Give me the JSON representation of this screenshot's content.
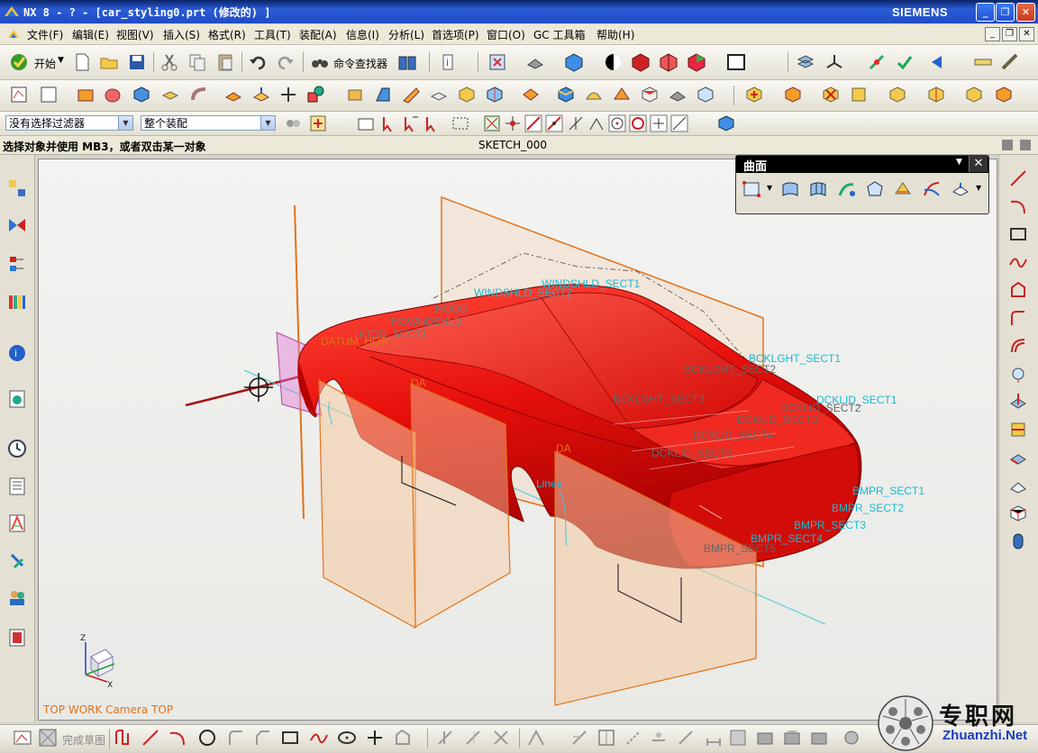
{
  "window": {
    "title": "NX 8 - ? - [car_styling0.prt  (修改的) ]",
    "brand": "SIEMENS",
    "minimize": "_",
    "restore": "❐",
    "close": "✕"
  },
  "menu": {
    "items": [
      "文件(F)",
      "编辑(E)",
      "视图(V)",
      "插入(S)",
      "格式(R)",
      "工具(T)",
      "装配(A)",
      "信息(I)",
      "分析(L)",
      "首选项(P)",
      "窗口(O)",
      "GC 工具箱",
      "帮助(H)"
    ]
  },
  "toolbar": {
    "start_label": "开始",
    "command_finder_label": "命令查找器"
  },
  "selection": {
    "filter_value": "没有选择过滤器",
    "scope_value": "整个装配"
  },
  "cue": {
    "text": "选择对象并使用 MB3，或者双击某一对象",
    "status": "SKETCH_000"
  },
  "panel": {
    "title": "曲面"
  },
  "viewport": {
    "view_name": "TOP WORK Camera TOP",
    "labels": [
      {
        "text": "WINDSHLD_SECT1",
        "color": "cyan"
      },
      {
        "text": "WINDSHLD_SECT2",
        "color": "cyan"
      },
      {
        "text": "HOOD",
        "color": "gray"
      },
      {
        "text": "HOWNDSHLD",
        "color": "gray"
      },
      {
        "text": "HOOD_SECT1",
        "color": "gray"
      },
      {
        "text": "DATUM_HOR",
        "color": "orange"
      },
      {
        "text": "BCKLGHT_SECT1",
        "color": "cyan"
      },
      {
        "text": "BCKLGHT_SECT2",
        "color": "gray"
      },
      {
        "text": "BCKLGHT_SECT3",
        "color": "gray"
      },
      {
        "text": "DCKLID_SECT1",
        "color": "cyan"
      },
      {
        "text": "DCKLID_SECT2",
        "color": "gray"
      },
      {
        "text": "DCKLID_SECT3",
        "color": "gray"
      },
      {
        "text": "DCKLID_SECT4",
        "color": "gray"
      },
      {
        "text": "DCKLID_SECT5",
        "color": "gray"
      },
      {
        "text": "BMPR_SECT1",
        "color": "cyan"
      },
      {
        "text": "BMPR_SECT2",
        "color": "cyan"
      },
      {
        "text": "BMPR_SECT3",
        "color": "cyan"
      },
      {
        "text": "BMPR_SECT4",
        "color": "cyan"
      },
      {
        "text": "BMPR_SECT5",
        "color": "gray"
      },
      {
        "text": "Lines",
        "color": "cyan"
      },
      {
        "text": "DA",
        "color": "orange"
      }
    ]
  },
  "sketch": {
    "finish_label": "完成草图"
  },
  "watermark": {
    "cn": "专职网",
    "en": "Zhuanzhi.Net"
  },
  "colors": {
    "car": "#e8100c",
    "plane": "#e8a060",
    "label_cyan": "#18b8d0"
  }
}
